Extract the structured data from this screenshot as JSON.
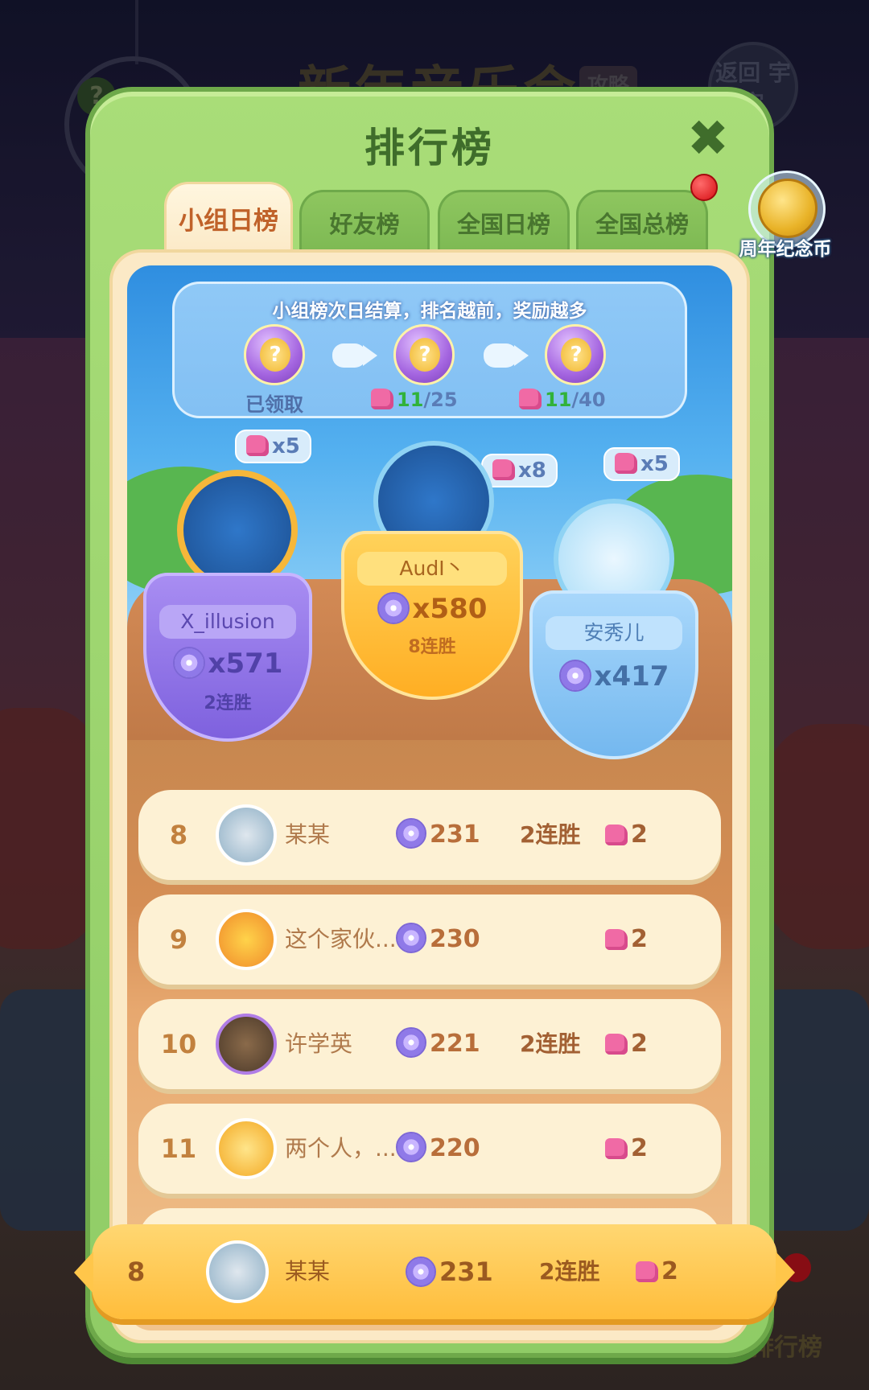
{
  "background": {
    "event_title": "新年音乐会",
    "guide_tag": "攻略",
    "back_button": "返回 宇宙",
    "help_icon": "?",
    "rank_label": "排行榜"
  },
  "modal": {
    "title": "排行榜",
    "close_icon": "close-x",
    "tabs": [
      {
        "label": "小组日榜",
        "active": true
      },
      {
        "label": "好友榜",
        "active": false
      },
      {
        "label": "全国日榜",
        "active": false
      },
      {
        "label": "全国总榜",
        "active": false
      }
    ],
    "anniversary_coin": {
      "label": "周年纪念币",
      "has_notification": true
    }
  },
  "reward_banner": {
    "text": "小组榜次日结算，排名越前，奖励越多",
    "rewards": [
      {
        "state": "已领取"
      },
      {
        "have": "11",
        "need": "/25"
      },
      {
        "have": "11",
        "need": "/40"
      }
    ]
  },
  "podium": [
    {
      "place": 2,
      "name": "X_illusion",
      "score": "x571",
      "streak": "2连胜",
      "pieces": "x5"
    },
    {
      "place": 1,
      "name": "AudI丶",
      "score": "x580",
      "streak": "8连胜",
      "pieces": "x8"
    },
    {
      "place": 3,
      "name": "安秀儿",
      "score": "x417",
      "streak": "",
      "pieces": "x5"
    }
  ],
  "list": [
    {
      "rank": "8",
      "name": "某某",
      "score": "231",
      "streak": "2连胜",
      "pieces": "2"
    },
    {
      "rank": "9",
      "name": "这个家伙...",
      "score": "230",
      "streak": "",
      "pieces": "2"
    },
    {
      "rank": "10",
      "name": "许学英",
      "score": "221",
      "streak": "2连胜",
      "pieces": "2"
    },
    {
      "rank": "11",
      "name": "两个人，...",
      "score": "220",
      "streak": "",
      "pieces": "2"
    }
  ],
  "my_rank": {
    "rank": "8",
    "name": "某某",
    "score": "231",
    "streak": "2连胜",
    "pieces": "2"
  },
  "colors": {
    "panel_green": "#9fd56f",
    "cream": "#fbe9c6",
    "active_tab_text": "#c0622a",
    "gold_bar": "#ffc64a",
    "streak_text": "#a26033"
  }
}
